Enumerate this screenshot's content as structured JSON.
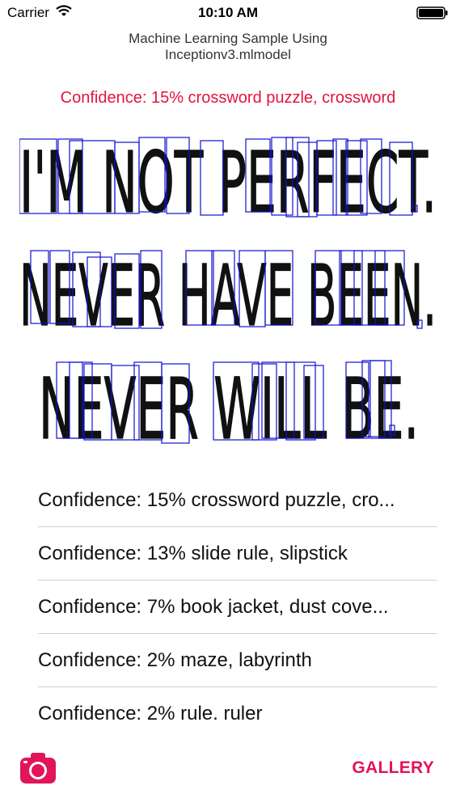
{
  "status": {
    "carrier": "Carrier",
    "time": "10:10 AM"
  },
  "header": {
    "title_line1": "Machine Learning Sample Using",
    "title_line2": "Inceptionv3.mlmodel"
  },
  "top_result": "Confidence: 15% crossword puzzle, crossword",
  "image": {
    "text_line1": "I'M NOT PERFECT.",
    "text_line2": "NEVER HAVE BEEN.",
    "text_line3": "NEVER WILL BE.",
    "box_color": "#1010d0"
  },
  "results": [
    "Confidence: 15% crossword puzzle, cro...",
    "Confidence: 13% slide rule, slipstick",
    "Confidence: 7% book jacket, dust cove...",
    "Confidence: 2% maze, labyrinth",
    "Confidence: 2% rule, ruler"
  ],
  "toolbar": {
    "camera_icon": "camera-icon",
    "gallery_label": "GALLERY"
  },
  "colors": {
    "accent": "#e2145a",
    "confidence_text": "#e2143c"
  }
}
